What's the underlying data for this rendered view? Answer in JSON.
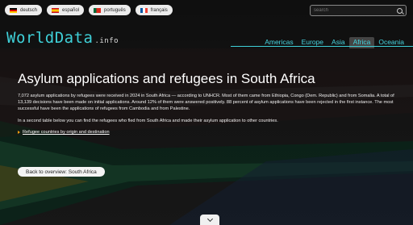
{
  "languages": [
    {
      "label": "deutsch",
      "flag": "de-flag-icon"
    },
    {
      "label": "español",
      "flag": "es-flag-icon"
    },
    {
      "label": "português",
      "flag": "pt-flag-icon"
    },
    {
      "label": "français",
      "flag": "fr-flag-icon"
    }
  ],
  "search": {
    "placeholder": "search"
  },
  "logo": {
    "main": "WorldData",
    "suffix": ".info"
  },
  "nav": {
    "items": [
      "Americas",
      "Europe",
      "Asia",
      "Africa",
      "Oceania"
    ],
    "active": "Africa"
  },
  "page": {
    "title": "Asylum applications and refugees in South Africa",
    "paragraph1": "7,072 asylum applications by refugees were received in 2024 in South Africa — according to UNHCR. Most of them came from Ethiopia, Congo (Dem. Republic) and from Somalia. A total of 13,139 decisions have been made on initial applications. Around 12% of them were answered positively. 88 percent of asylum applications have been rejected in the first instance. The most successful have been the applications of refugees from Cambodia and from Palestine.",
    "paragraph2": "In a second table below you can find the refugees who fled from South Africa and made their asylum application to other countries.",
    "link": "Refugee countries by origin and destination",
    "back_button": "Back to overview: South Africa"
  },
  "colors": {
    "accent": "#3fd0d8",
    "link_arrow": "#f39c12"
  }
}
